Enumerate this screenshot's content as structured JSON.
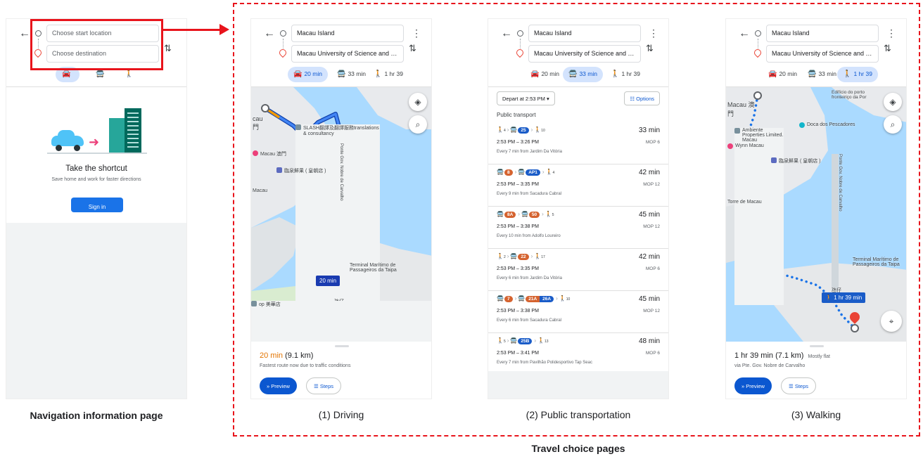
{
  "navigation_page": {
    "start_placeholder": "Choose start location",
    "dest_placeholder": "Choose destination",
    "shortcut_title": "Take the shortcut",
    "shortcut_subtitle": "Save home and work for faster directions",
    "signin_label": "Sign in"
  },
  "route": {
    "start": "Macau Island",
    "destination": "Macau University of Science and Tec..."
  },
  "modes": {
    "drive": "20 min",
    "transit": "33 min",
    "walk": "1 hr 39"
  },
  "driving": {
    "time": "20 min",
    "distance": "(9.1 km)",
    "subtitle": "Fastest route now due to traffic conditions",
    "badge": "20 min",
    "preview_label": "Preview",
    "steps_label": "Steps",
    "map_labels": {
      "slash": "SLASH翻譯及翻譯服務translations & consultancy",
      "cau": "cau",
      "men": "門",
      "macau_left": "Macau",
      "poi_pink": "Macau 澳門",
      "store": "臨泉鮮果 ( 皇朝店 )",
      "terminal": "Terminal Marítimo de Passageiros da Taipa",
      "taipa": "氹仔 Taipa",
      "shop": "op 美華店",
      "bridge": "Ponte Gov. Nobre de Carvalho"
    }
  },
  "transit": {
    "depart_label": "Depart at 2:53 PM",
    "options_label": "Options",
    "section_title": "Public transport",
    "routes": [
      {
        "seg1": "4",
        "bus1": "25",
        "bus1_color": "#1a5cc8",
        "seg3": "10",
        "duration": "33 min",
        "times": "2:53 PM – 3:26 PM",
        "fare": "MOP 6",
        "every": "Every 7 min from Jardim Da Vitória"
      },
      {
        "bus1": "8",
        "bus1_color": "#d5632f",
        "bus2": "AP1",
        "bus2_color": "#1a5cc8",
        "seg3": "4",
        "duration": "42 min",
        "times": "2:53 PM – 3:35 PM",
        "fare": "MOP 12",
        "every": "Every 9 min from Sacadura Cabral"
      },
      {
        "bus1": "8A",
        "bus1_color": "#d5632f",
        "bus2": "50",
        "bus2_color": "#d5632f",
        "seg3": "5",
        "duration": "45 min",
        "times": "2:53 PM – 3:38 PM",
        "fare": "MOP 12",
        "every": "Every 10 min from Adolfo Loureiro"
      },
      {
        "seg1": "2",
        "bus1": "22",
        "bus1_color": "#d5632f",
        "seg3": "17",
        "duration": "42 min",
        "times": "2:53 PM – 3:35 PM",
        "fare": "MOP 6",
        "every": "Every 6 min from Jardim Da Vitória"
      },
      {
        "bus1": "7",
        "bus1_color": "#d5632f",
        "bus2": "21A",
        "bus2_color": "#d5632f",
        "bus2b": "26A",
        "bus2b_color": "#1a5cc8",
        "seg3": "10",
        "duration": "45 min",
        "times": "2:53 PM – 3:38 PM",
        "fare": "MOP 12",
        "every": "Every 6 min from Sacadura Cabral"
      },
      {
        "seg1": "5",
        "bus1": "25B",
        "bus1_color": "#1a5cc8",
        "seg3": "13",
        "duration": "48 min",
        "times": "2:53 PM – 3:41 PM",
        "fare": "MOP 6",
        "every": "Every 7 min from Pavilhão Polidesportivo Tap Seac"
      }
    ]
  },
  "walking": {
    "time": "1 hr 39 min",
    "distance": "(7.1 km)",
    "flat": "Mostly flat",
    "subtitle": "via Pte. Gov. Nobre de Carvalho",
    "badge": "1 hr 39 min",
    "preview_label": "Preview",
    "steps_label": "Steps",
    "map_labels": {
      "edificio": "Edifício do porto fronteiriço da Por",
      "macau": "Macau 澳門",
      "ambiente": "Ambiente Properties Limited. Macau",
      "doca": "Doca dos Pescadores",
      "wynn": "Wynn Macau",
      "store": "臨泉鮮果 ( 皇朝店 )",
      "torre": "Torre de Macau",
      "terminal": "Terminal Marítimo de Passageiros da Taipa",
      "taipa": "氹仔",
      "bridge": "Ponte Gov. Nobre de Carvalho"
    }
  },
  "captions": {
    "nav": "Navigation information page",
    "driving": "(1) Driving",
    "transit": "(2) Public transportation",
    "walking": "(3) Walking",
    "travel": "Travel choice pages"
  },
  "colors": {
    "annotation_red": "#e8141c",
    "accent_blue": "#0b57d0",
    "route_blue": "#1a3bb0",
    "traffic_orange": "#f29900"
  },
  "icons": [
    "back-arrow-icon",
    "swap-icon",
    "more-vert-icon",
    "car-icon",
    "bus-icon",
    "walk-icon",
    "layers-icon",
    "search-icon",
    "my-location-icon",
    "tune-icon",
    "list-icon",
    "chevrons-right-icon"
  ]
}
